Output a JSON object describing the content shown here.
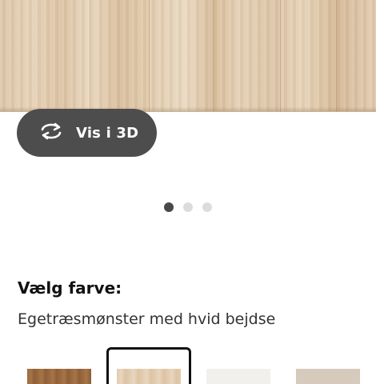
{
  "product": {
    "image_name": "product-image-oak-white-stained"
  },
  "view3d": {
    "label": "Vis i 3D",
    "icon": "rotate-3d-icon"
  },
  "carousel": {
    "dot_count": 3,
    "active_index": 0
  },
  "color_picker": {
    "heading": "Vælg farve:",
    "selected_name": "Egetræsmønster med hvid bejdse",
    "selected_index": 1,
    "swatches": [
      {
        "color": "#9c6a3f"
      },
      {
        "color": "#e2ccb0"
      },
      {
        "color": "#f2f0ec"
      },
      {
        "color": "#d5cabb"
      }
    ]
  }
}
